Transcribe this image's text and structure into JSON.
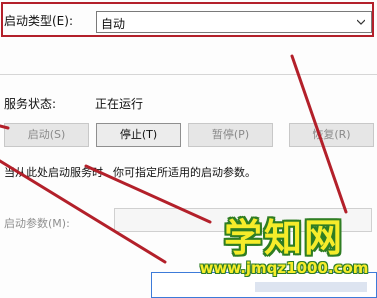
{
  "startup_type": {
    "label": "启动类型(E):",
    "selected": "自动"
  },
  "service_status": {
    "label": "服务状态:",
    "value": "正在运行"
  },
  "buttons": {
    "start": "启动(S)",
    "stop": "停止(T)",
    "pause": "暂停(P)",
    "resume": "恢复(R)"
  },
  "hint": {
    "part1": "当从此处启动服务时",
    "part2": "你可指定所适用的启动参数。"
  },
  "start_params": {
    "label": "启动参数(M):",
    "value": ""
  },
  "watermark": {
    "title": "学知网",
    "url": "www.jmqz1000.com"
  },
  "colors": {
    "annotation_red": "#b3202a",
    "watermark_yellow": "#f6ec2a",
    "watermark_green": "#2f7d23"
  }
}
